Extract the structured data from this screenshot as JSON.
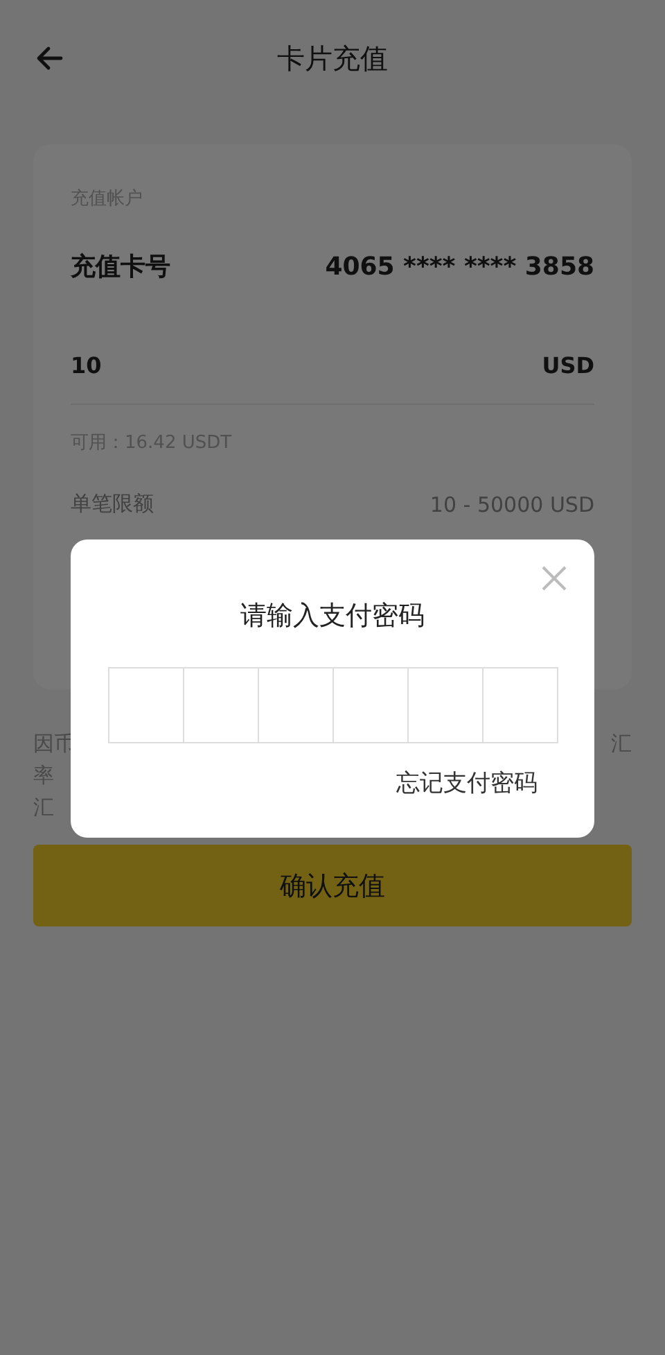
{
  "header": {
    "title": "卡片充值"
  },
  "card": {
    "account_label": "充值帐户",
    "card_label": "充值卡号",
    "card_number": "4065 **** **** 3858",
    "amount": "10",
    "currency": "USD",
    "available": "可用：16.42 USDT",
    "limit_label": "单笔限额",
    "limit_value": "10 - 50000 USD"
  },
  "note": {
    "left_lines": [
      "因币",
      "率",
      "汇"
    ],
    "right_lines": [
      "汇"
    ]
  },
  "confirm_button": "确认充值",
  "dialog": {
    "title": "请输入支付密码",
    "pin_boxes": [
      {
        "filled": false
      },
      {
        "filled": false
      },
      {
        "filled": false
      },
      {
        "filled": false
      },
      {
        "filled": false
      },
      {
        "filled": false
      }
    ],
    "forgot_link": "忘记支付密码"
  }
}
